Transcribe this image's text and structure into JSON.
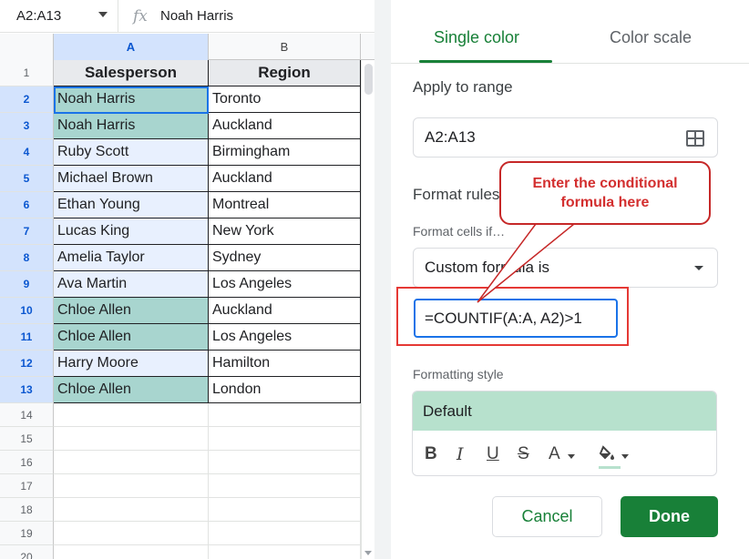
{
  "formula_bar": {
    "name_box": "A2:A13",
    "fx_symbol": "fx",
    "content": "Noah Harris"
  },
  "columns": [
    {
      "letter": "A",
      "selected": true
    },
    {
      "letter": "B",
      "selected": false
    }
  ],
  "headers": {
    "a": "Salesperson",
    "b": "Region"
  },
  "rows": [
    {
      "num": "2",
      "name": "Noah Harris",
      "region": "Toronto",
      "duplicate": true
    },
    {
      "num": "3",
      "name": "Noah Harris",
      "region": "Auckland",
      "duplicate": true
    },
    {
      "num": "4",
      "name": "Ruby Scott",
      "region": "Birmingham",
      "duplicate": false
    },
    {
      "num": "5",
      "name": "Michael Brown",
      "region": "Auckland",
      "duplicate": false
    },
    {
      "num": "6",
      "name": "Ethan Young",
      "region": "Montreal",
      "duplicate": false
    },
    {
      "num": "7",
      "name": "Lucas King",
      "region": "New York",
      "duplicate": false
    },
    {
      "num": "8",
      "name": "Amelia Taylor",
      "region": "Sydney",
      "duplicate": false
    },
    {
      "num": "9",
      "name": "Ava Martin",
      "region": "Los Angeles",
      "duplicate": false
    },
    {
      "num": "10",
      "name": "Chloe Allen",
      "region": "Auckland",
      "duplicate": true
    },
    {
      "num": "11",
      "name": "Chloe Allen",
      "region": "Los Angeles",
      "duplicate": true
    },
    {
      "num": "12",
      "name": "Harry Moore",
      "region": "Hamilton",
      "duplicate": false
    },
    {
      "num": "13",
      "name": "Chloe Allen",
      "region": "London",
      "duplicate": true
    }
  ],
  "header_row_num": "1",
  "empty_rows": [
    "14",
    "15",
    "16",
    "17",
    "18",
    "19",
    "20"
  ],
  "panel": {
    "tab_single": "Single color",
    "tab_scale": "Color scale",
    "apply_label": "Apply to range",
    "range_value": "A2:A13",
    "format_rules_label": "Format rules",
    "format_cells_if": "Format cells if…",
    "condition": "Custom formula is",
    "formula": "=COUNTIF(A:A, A2)>1",
    "formatting_style_label": "Formatting style",
    "style_preset": "Default",
    "tools": {
      "bold": "B",
      "italic": "I",
      "underline": "U",
      "strike": "S",
      "text_color": "A"
    },
    "cancel": "Cancel",
    "done": "Done"
  },
  "callout": {
    "line1": "Enter the conditional",
    "line2": "formula here"
  },
  "colors": {
    "accent_green": "#188038",
    "duplicate_fill": "#a8d5cf",
    "range_fill": "#e8f0fe",
    "style_preview": "#b7e1cd",
    "callout_red": "#d32f2f"
  }
}
